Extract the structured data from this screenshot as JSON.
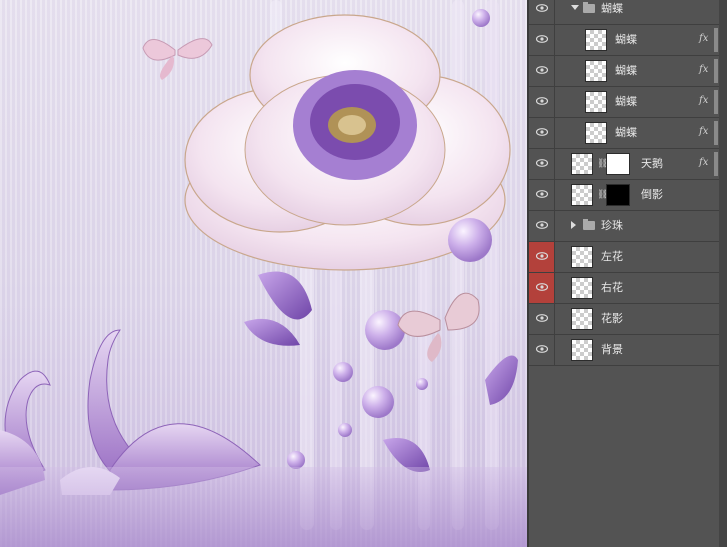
{
  "layers": [
    {
      "name": "蝴蝶",
      "kind": "group",
      "open": true,
      "indent": false,
      "fx": false,
      "selected": false
    },
    {
      "name": "蝴蝶",
      "kind": "layer",
      "indent": true,
      "fx": true,
      "mask": false,
      "selected": false
    },
    {
      "name": "蝴蝶",
      "kind": "layer",
      "indent": true,
      "fx": true,
      "mask": false,
      "selected": false
    },
    {
      "name": "蝴蝶",
      "kind": "layer",
      "indent": true,
      "fx": true,
      "mask": false,
      "selected": false
    },
    {
      "name": "蝴蝶",
      "kind": "layer",
      "indent": true,
      "fx": true,
      "mask": false,
      "selected": false
    },
    {
      "name": "天鹅",
      "kind": "layer",
      "indent": false,
      "fx": true,
      "mask": true,
      "maskColor": "#ffffff",
      "selected": false
    },
    {
      "name": "倒影",
      "kind": "layer",
      "indent": false,
      "fx": false,
      "mask": true,
      "maskColor": "#000000",
      "selected": false
    },
    {
      "name": "珍珠",
      "kind": "group",
      "open": false,
      "indent": false,
      "fx": false,
      "selected": false
    },
    {
      "name": "左花",
      "kind": "layer",
      "indent": false,
      "fx": false,
      "mask": false,
      "selected": true
    },
    {
      "name": "右花",
      "kind": "layer",
      "indent": false,
      "fx": false,
      "mask": false,
      "selected": true
    },
    {
      "name": "花影",
      "kind": "layer",
      "indent": false,
      "fx": false,
      "mask": false,
      "selected": false
    },
    {
      "name": "背景",
      "kind": "layer",
      "indent": false,
      "fx": false,
      "mask": false,
      "selected": false
    }
  ],
  "fx_label": "fx",
  "colors": {
    "selected_eye": "#b3413b",
    "panel_bg": "#535353",
    "accent_purple": "#8c5cc0"
  },
  "icons": {
    "eye": "eye-icon",
    "folder": "folder-icon",
    "link": "link-icon",
    "collapse": "chevron-down-icon",
    "expand": "chevron-right-icon"
  }
}
